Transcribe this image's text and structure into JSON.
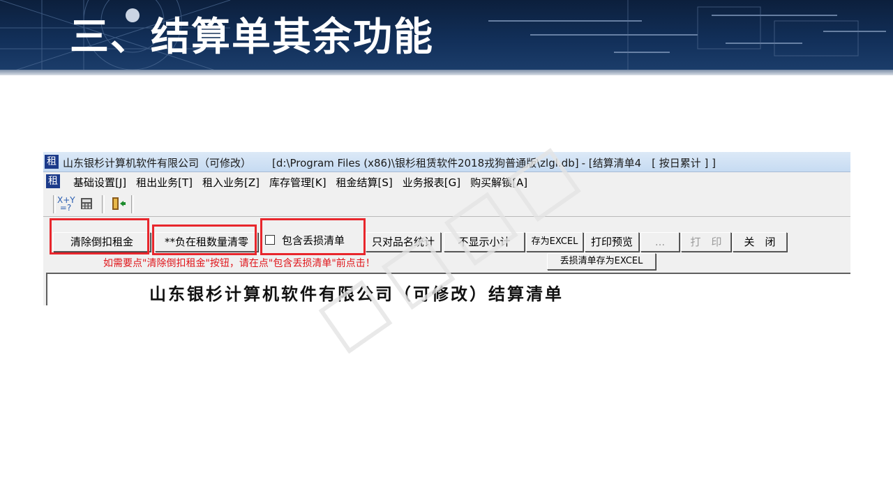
{
  "slide": {
    "title": "三、结算单其余功能"
  },
  "window": {
    "icon_char": "租",
    "title_company": "山东银杉计算机软件有限公司（可修改）",
    "title_path": "[d:\\Program Files (x86)\\银杉租赁软件2018戎狗普通版\\zlgl.db]",
    "title_report": "- [结算清单4　[ 按日累计 ] ]"
  },
  "menu": {
    "items": [
      {
        "label": "基础设置[J]"
      },
      {
        "label": "租出业务[T]"
      },
      {
        "label": "租入业务[Z]"
      },
      {
        "label": "库存管理[K]"
      },
      {
        "label": "租金结算[S]"
      },
      {
        "label": "业务报表[G]"
      },
      {
        "label": "购买解锁[A]"
      }
    ]
  },
  "toolbar": {
    "icons": [
      "calculator-formula-icon",
      "calculator-icon",
      "exit-door-icon"
    ],
    "formula_top": "X+Y",
    "formula_bottom": "=?"
  },
  "buttons": {
    "clear_deduct_rent": "清除倒扣租金",
    "clear_negative_qty": "**负在租数量清零",
    "include_loss_label": "包含丢损清单",
    "only_by_name": "只对品名统计",
    "hide_subtotal": "不显示小计",
    "save_excel": "存为EXCEL",
    "print_preview": "打印预览",
    "more": "...",
    "print": "打　印",
    "close": "关　闭",
    "save_loss_excel": "丢损清单存为EXCEL"
  },
  "hint_text": "如需要点\"清除倒扣租金\"按钮，请在点\"包含丢损清单\"前点击！",
  "report": {
    "title": "山东银杉计算机软件有限公司（可修改）结算清单"
  },
  "colors": {
    "highlight": "#e8262c",
    "hint": "#e0151a",
    "banner": "#12305a"
  }
}
